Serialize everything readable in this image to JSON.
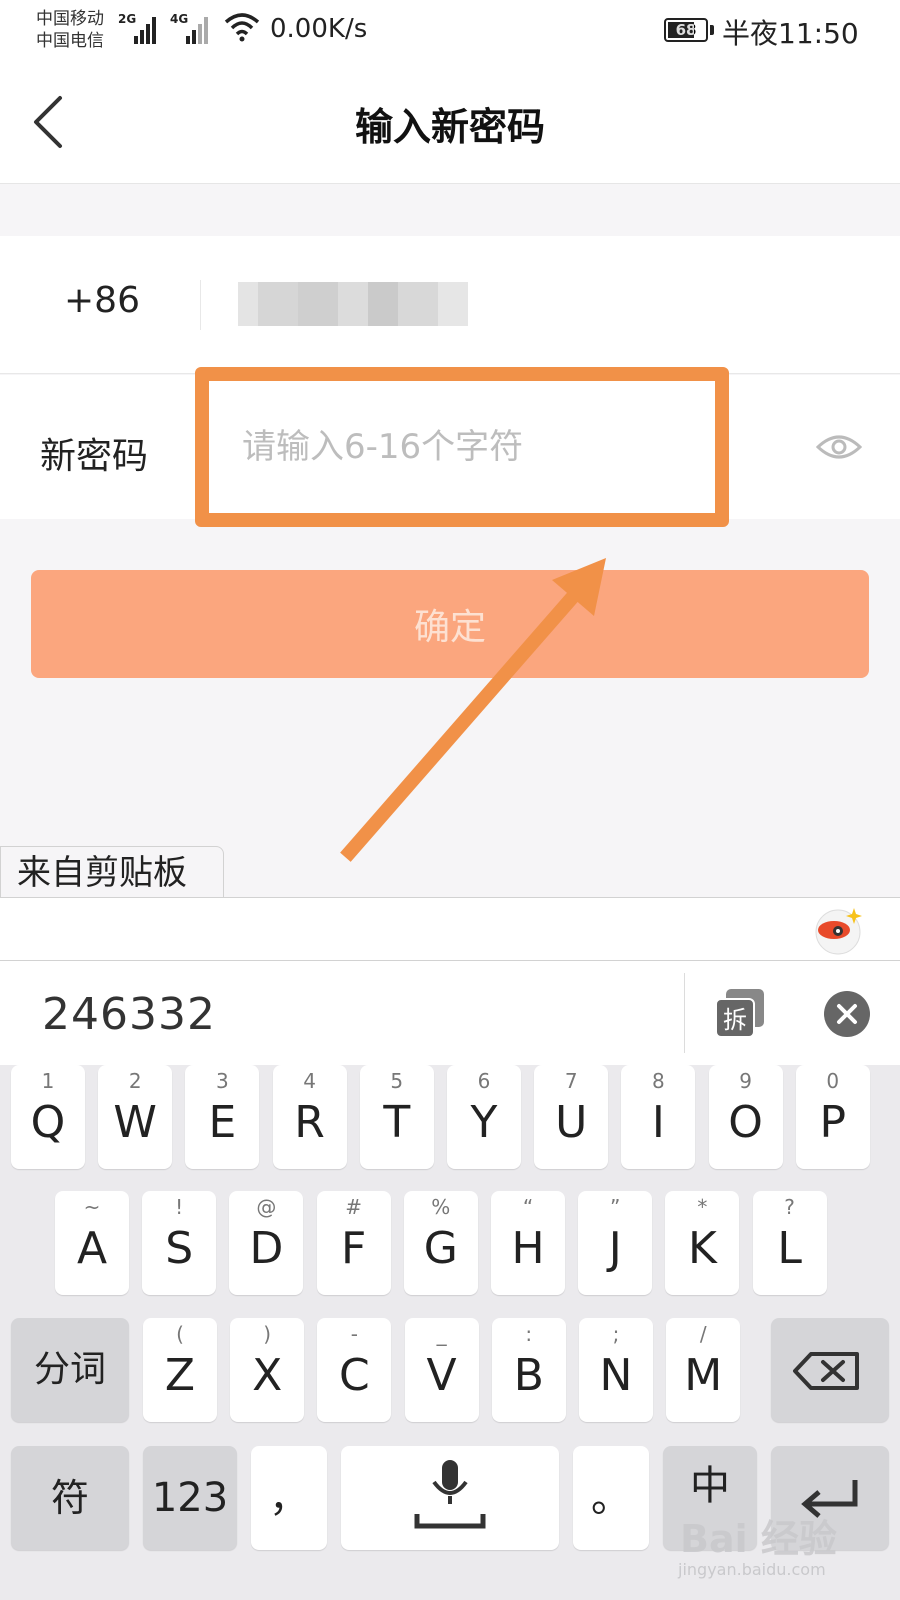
{
  "status_bar": {
    "carrier_1": "中国移动",
    "carrier_2": "中国电信",
    "signal_1_label": "2G",
    "signal_2_label": "4G",
    "net_speed": "0.00K/s",
    "battery_level": "68",
    "time": "半夜11:50"
  },
  "nav": {
    "title": "输入新密码"
  },
  "form": {
    "country_code": "+86",
    "password_label": "新密码",
    "password_placeholder": "请输入6-16个字符",
    "confirm_label": "确定"
  },
  "clipboard": {
    "tab_label": "来自剪贴板",
    "content": "246332",
    "split_icon_char": "拆"
  },
  "keyboard": {
    "row1": [
      {
        "main": "Q",
        "sub": "1"
      },
      {
        "main": "W",
        "sub": "2"
      },
      {
        "main": "E",
        "sub": "3"
      },
      {
        "main": "R",
        "sub": "4"
      },
      {
        "main": "T",
        "sub": "5"
      },
      {
        "main": "Y",
        "sub": "6"
      },
      {
        "main": "U",
        "sub": "7"
      },
      {
        "main": "I",
        "sub": "8"
      },
      {
        "main": "O",
        "sub": "9"
      },
      {
        "main": "P",
        "sub": "0"
      }
    ],
    "row2": [
      {
        "main": "A",
        "sub": "~"
      },
      {
        "main": "S",
        "sub": "!"
      },
      {
        "main": "D",
        "sub": "@"
      },
      {
        "main": "F",
        "sub": "#"
      },
      {
        "main": "G",
        "sub": "%"
      },
      {
        "main": "H",
        "sub": "“"
      },
      {
        "main": "J",
        "sub": "”"
      },
      {
        "main": "K",
        "sub": "*"
      },
      {
        "main": "L",
        "sub": "?"
      }
    ],
    "row3": [
      {
        "main": "Z",
        "sub": "("
      },
      {
        "main": "X",
        "sub": ")"
      },
      {
        "main": "C",
        "sub": "-"
      },
      {
        "main": "V",
        "sub": "_"
      },
      {
        "main": "B",
        "sub": ":"
      },
      {
        "main": "N",
        "sub": ";"
      },
      {
        "main": "M",
        "sub": "/"
      }
    ],
    "segment_key": "分词",
    "symbol_key": "符",
    "number_key": "123",
    "comma_key": "，",
    "period_key": "。",
    "chinese_key": "中"
  },
  "watermark": {
    "brand": "Bai 经验",
    "url": "jingyan.baidu.com"
  },
  "colors": {
    "accent": "#f19148",
    "confirm_button": "#fba67e",
    "confirm_text": "#fde1d2",
    "placeholder": "#bdbdbd",
    "keyboard_bg": "#ebeaed"
  }
}
